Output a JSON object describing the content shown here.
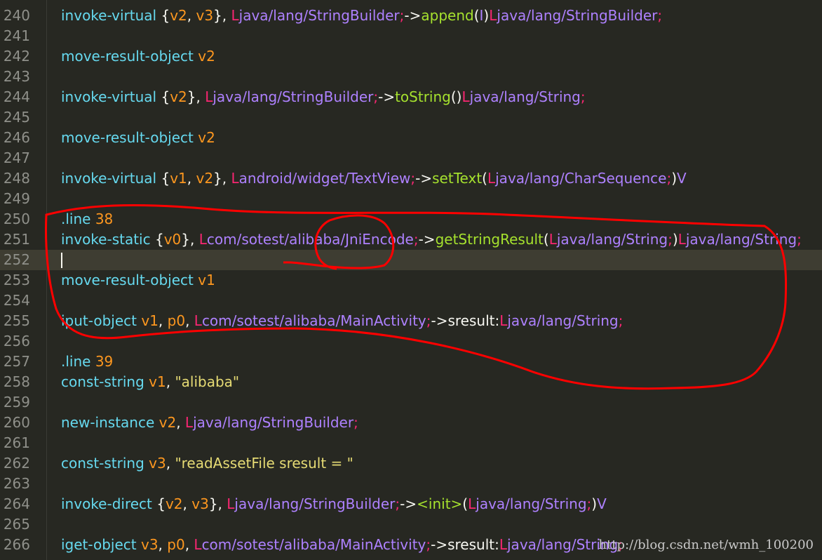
{
  "editor": {
    "lines": [
      {
        "n": "240",
        "tokens": [
          [
            "t-ins",
            "invoke-virtual "
          ],
          [
            "t-plain",
            "{"
          ],
          [
            "t-reg",
            "v2"
          ],
          [
            "t-plain",
            ", "
          ],
          [
            "t-reg",
            "v3"
          ],
          [
            "t-plain",
            "}, "
          ],
          [
            "t-L",
            "L"
          ],
          [
            "t-type",
            "java/lang/StringBuilder"
          ],
          [
            "t-sem",
            ";"
          ],
          [
            "t-plain",
            "->"
          ],
          [
            "t-fn",
            "append"
          ],
          [
            "t-plain",
            "("
          ],
          [
            "t-type",
            "I"
          ],
          [
            "t-plain",
            ")"
          ],
          [
            "t-L",
            "L"
          ],
          [
            "t-type",
            "java/lang/StringBuilder"
          ],
          [
            "t-sem",
            ";"
          ]
        ]
      },
      {
        "n": "241",
        "tokens": []
      },
      {
        "n": "242",
        "tokens": [
          [
            "t-ins",
            "move-result-object "
          ],
          [
            "t-reg",
            "v2"
          ]
        ]
      },
      {
        "n": "243",
        "tokens": []
      },
      {
        "n": "244",
        "tokens": [
          [
            "t-ins",
            "invoke-virtual "
          ],
          [
            "t-plain",
            "{"
          ],
          [
            "t-reg",
            "v2"
          ],
          [
            "t-plain",
            "}, "
          ],
          [
            "t-L",
            "L"
          ],
          [
            "t-type",
            "java/lang/StringBuilder"
          ],
          [
            "t-sem",
            ";"
          ],
          [
            "t-plain",
            "->"
          ],
          [
            "t-fn",
            "toString"
          ],
          [
            "t-plain",
            "()"
          ],
          [
            "t-L",
            "L"
          ],
          [
            "t-type",
            "java/lang/String"
          ],
          [
            "t-sem",
            ";"
          ]
        ]
      },
      {
        "n": "245",
        "tokens": []
      },
      {
        "n": "246",
        "tokens": [
          [
            "t-ins",
            "move-result-object "
          ],
          [
            "t-reg",
            "v2"
          ]
        ]
      },
      {
        "n": "247",
        "tokens": []
      },
      {
        "n": "248",
        "tokens": [
          [
            "t-ins",
            "invoke-virtual "
          ],
          [
            "t-plain",
            "{"
          ],
          [
            "t-reg",
            "v1"
          ],
          [
            "t-plain",
            ", "
          ],
          [
            "t-reg",
            "v2"
          ],
          [
            "t-plain",
            "}, "
          ],
          [
            "t-L",
            "L"
          ],
          [
            "t-type",
            "android/widget/TextView"
          ],
          [
            "t-sem",
            ";"
          ],
          [
            "t-plain",
            "->"
          ],
          [
            "t-fn",
            "setText"
          ],
          [
            "t-plain",
            "("
          ],
          [
            "t-L",
            "L"
          ],
          [
            "t-type",
            "java/lang/CharSequence"
          ],
          [
            "t-sem",
            ";"
          ],
          [
            "t-plain",
            ")"
          ],
          [
            "t-type",
            "V"
          ]
        ]
      },
      {
        "n": "249",
        "tokens": []
      },
      {
        "n": "250",
        "tokens": [
          [
            "t-ins",
            ".line "
          ],
          [
            "t-num",
            "38"
          ]
        ]
      },
      {
        "n": "251",
        "tokens": [
          [
            "t-ins",
            "invoke-static "
          ],
          [
            "t-plain",
            "{"
          ],
          [
            "t-reg",
            "v0"
          ],
          [
            "t-plain",
            "}, "
          ],
          [
            "t-L",
            "L"
          ],
          [
            "t-type",
            "com/sotest/alibaba/JniEncode"
          ],
          [
            "t-sem",
            ";"
          ],
          [
            "t-plain",
            "->"
          ],
          [
            "t-fn",
            "getStringResult"
          ],
          [
            "t-plain",
            "("
          ],
          [
            "t-L",
            "L"
          ],
          [
            "t-type",
            "java/lang/String"
          ],
          [
            "t-sem",
            ";"
          ],
          [
            "t-plain",
            ")"
          ],
          [
            "t-L",
            "L"
          ],
          [
            "t-type",
            "java/lang/String"
          ],
          [
            "t-sem",
            ";"
          ]
        ]
      },
      {
        "n": "252",
        "tokens": [],
        "current": true
      },
      {
        "n": "253",
        "tokens": [
          [
            "t-ins",
            "move-result-object "
          ],
          [
            "t-reg",
            "v1"
          ]
        ]
      },
      {
        "n": "254",
        "tokens": []
      },
      {
        "n": "255",
        "tokens": [
          [
            "t-ins",
            "iput-object "
          ],
          [
            "t-reg",
            "v1"
          ],
          [
            "t-plain",
            ", "
          ],
          [
            "t-reg",
            "p0"
          ],
          [
            "t-plain",
            ", "
          ],
          [
            "t-L",
            "L"
          ],
          [
            "t-type",
            "com/sotest/alibaba/MainActivity"
          ],
          [
            "t-sem",
            ";"
          ],
          [
            "t-plain",
            "->sresult:"
          ],
          [
            "t-L",
            "L"
          ],
          [
            "t-type",
            "java/lang/String"
          ],
          [
            "t-sem",
            ";"
          ]
        ]
      },
      {
        "n": "256",
        "tokens": []
      },
      {
        "n": "257",
        "tokens": [
          [
            "t-ins",
            ".line "
          ],
          [
            "t-num",
            "39"
          ]
        ]
      },
      {
        "n": "258",
        "tokens": [
          [
            "t-ins",
            "const-string "
          ],
          [
            "t-reg",
            "v1"
          ],
          [
            "t-plain",
            ", "
          ],
          [
            "t-str",
            "\"alibaba\""
          ]
        ]
      },
      {
        "n": "259",
        "tokens": []
      },
      {
        "n": "260",
        "tokens": [
          [
            "t-ins",
            "new-instance "
          ],
          [
            "t-reg",
            "v2"
          ],
          [
            "t-plain",
            ", "
          ],
          [
            "t-L",
            "L"
          ],
          [
            "t-type",
            "java/lang/StringBuilder"
          ],
          [
            "t-sem",
            ";"
          ]
        ]
      },
      {
        "n": "261",
        "tokens": []
      },
      {
        "n": "262",
        "tokens": [
          [
            "t-ins",
            "const-string "
          ],
          [
            "t-reg",
            "v3"
          ],
          [
            "t-plain",
            ", "
          ],
          [
            "t-str",
            "\"readAssetFile sresult = \""
          ]
        ]
      },
      {
        "n": "263",
        "tokens": []
      },
      {
        "n": "264",
        "tokens": [
          [
            "t-ins",
            "invoke-direct "
          ],
          [
            "t-plain",
            "{"
          ],
          [
            "t-reg",
            "v2"
          ],
          [
            "t-plain",
            ", "
          ],
          [
            "t-reg",
            "v3"
          ],
          [
            "t-plain",
            "}, "
          ],
          [
            "t-L",
            "L"
          ],
          [
            "t-type",
            "java/lang/StringBuilder"
          ],
          [
            "t-sem",
            ";"
          ],
          [
            "t-plain",
            "->"
          ],
          [
            "t-fn",
            "<init>"
          ],
          [
            "t-plain",
            "("
          ],
          [
            "t-L",
            "L"
          ],
          [
            "t-type",
            "java/lang/String"
          ],
          [
            "t-sem",
            ";"
          ],
          [
            "t-plain",
            ")"
          ],
          [
            "t-type",
            "V"
          ]
        ]
      },
      {
        "n": "265",
        "tokens": []
      },
      {
        "n": "266",
        "tokens": [
          [
            "t-ins",
            "iget-object "
          ],
          [
            "t-reg",
            "v3"
          ],
          [
            "t-plain",
            ", "
          ],
          [
            "t-reg",
            "p0"
          ],
          [
            "t-plain",
            ", "
          ],
          [
            "t-L",
            "L"
          ],
          [
            "t-type",
            "com/sotest/alibaba/MainActivity"
          ],
          [
            "t-sem",
            ";"
          ],
          [
            "t-plain",
            "->sresult:"
          ],
          [
            "t-L",
            "L"
          ],
          [
            "t-type",
            "java/lang/String"
          ],
          [
            "t-sem",
            ";"
          ]
        ]
      }
    ]
  },
  "watermark": "http://blog.csdn.net/wmh_100200",
  "colors": {
    "background": "#272822",
    "annotation": "#ff0000"
  }
}
